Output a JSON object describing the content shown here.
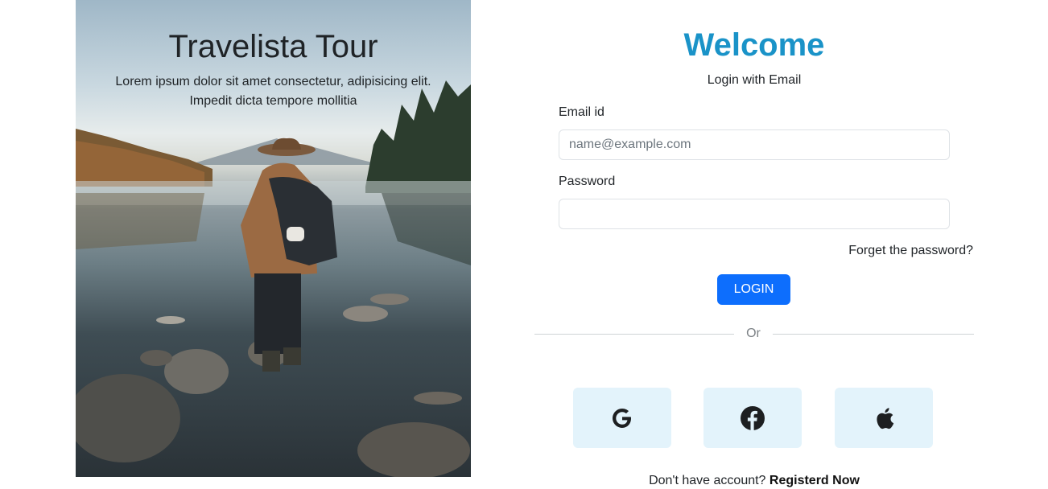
{
  "hero": {
    "title": "Travelista Tour",
    "subtitle": "Lorem ipsum dolor sit amet consectetur, adipisicing elit. Impedit dicta tempore mollitia"
  },
  "login": {
    "title": "Welcome",
    "subtitle": "Login with Email",
    "email_label": "Email id",
    "email_placeholder": "name@example.com",
    "email_value": "",
    "password_label": "Password",
    "password_value": "",
    "forgot_text": "Forget the password?",
    "login_button": "LOGIN",
    "divider_text": "Or",
    "social": [
      {
        "icon": "google-icon"
      },
      {
        "icon": "facebook-icon"
      },
      {
        "icon": "apple-icon"
      }
    ],
    "footer_prompt": "Don't have account?",
    "register_text": "Registerd Now"
  },
  "colors": {
    "accent_title": "#1a93c8",
    "primary_button": "#0d6efd",
    "social_bg": "#e3f3fb"
  }
}
